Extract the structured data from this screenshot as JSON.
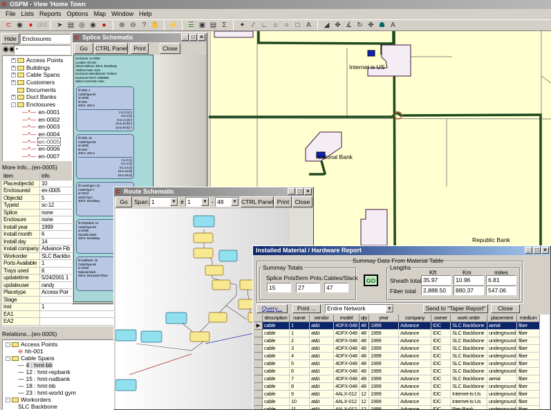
{
  "app": {
    "title": "OSPM - View 'Home Town"
  },
  "menu": [
    "File",
    "Lists",
    "Reports",
    "Options",
    "Map",
    "Window",
    "Help"
  ],
  "left": {
    "hide_label": "Hide",
    "layer_select": "Enclosures",
    "search_value": "*",
    "tree": [
      {
        "label": "Access Points",
        "level": 0,
        "exp": "+"
      },
      {
        "label": "Buildings",
        "level": 0,
        "exp": "+"
      },
      {
        "label": "Cable Spans",
        "level": 0,
        "exp": "+"
      },
      {
        "label": "Customers",
        "level": 0,
        "exp": "+"
      },
      {
        "label": "Documents",
        "level": 0,
        "exp": ""
      },
      {
        "label": "Duct Banks",
        "level": 0,
        "exp": "+"
      },
      {
        "label": "Enclosures",
        "level": 0,
        "exp": "-"
      },
      {
        "label": "en-0001",
        "level": 1
      },
      {
        "label": "en-0002",
        "level": 1
      },
      {
        "label": "en-0003",
        "level": 1
      },
      {
        "label": "en-0004",
        "level": 1
      },
      {
        "label": "en-0005",
        "level": 1,
        "selected": true
      },
      {
        "label": "en-0006",
        "level": 1
      },
      {
        "label": "en-0007",
        "level": 1
      }
    ],
    "more_info_title": "More Info...(en-0005)",
    "info_headers": [
      "item",
      "info"
    ],
    "info_rows": [
      [
        "Placeobjectid",
        "10"
      ],
      [
        "Enclosureid",
        "en-0005"
      ],
      [
        "Objectid",
        "5"
      ],
      [
        "Typeid",
        "sc-12"
      ],
      [
        "Splice",
        "none"
      ],
      [
        "Enclosure",
        "none"
      ],
      [
        "Install year",
        "1999"
      ],
      [
        "Install month",
        "6"
      ],
      [
        "Install day",
        "14"
      ],
      [
        "Install company",
        "Advance Fib"
      ],
      [
        "Workorder",
        "SLC Backbo"
      ],
      [
        "Ports Available",
        "1"
      ],
      [
        "Trays used",
        "6"
      ],
      [
        "updatetime",
        "5/24/2001 1"
      ],
      [
        "updateuser",
        "randy"
      ],
      [
        "Placetype",
        "Access Poir"
      ],
      [
        "Stage",
        ""
      ],
      [
        "inst",
        "1"
      ],
      [
        "EA1",
        ""
      ],
      [
        "EA2",
        ""
      ]
    ],
    "relations_title": "Relations...(en-0005)",
    "relations": [
      {
        "label": "Access Points",
        "level": 0,
        "kind": "folder"
      },
      {
        "label": "hh-001",
        "level": 1,
        "kind": "ap"
      },
      {
        "label": "Cable Spans",
        "level": 0,
        "kind": "folder"
      },
      {
        "label": "4 : hmt-bb",
        "level": 1,
        "kind": "span",
        "selected": true
      },
      {
        "label": "12 : hmt-repbank",
        "level": 1,
        "kind": "span"
      },
      {
        "label": "15 : hmt-natbank",
        "level": 1,
        "kind": "span"
      },
      {
        "label": "18 : hmt-bb",
        "level": 1,
        "kind": "span"
      },
      {
        "label": "23 : hmt-world gym",
        "level": 1,
        "kind": "span"
      },
      {
        "label": "Workorders",
        "level": 0,
        "kind": "folder"
      },
      {
        "label": "SLC Backbone",
        "level": 1,
        "kind": "wo"
      }
    ]
  },
  "splice": {
    "title": "Splice Schematic",
    "go": "Go",
    "ctrl": "CTRL Panel",
    "print": "Print",
    "close": "Close",
    "header": [
      "Enclosure: en-0005",
      "Location: hh-001",
      "Street Address: 300 E. Broadway",
      "Address Note: none",
      "Enclosure Manufacturer: Preform",
      "Enclosure Part #: 0000950",
      "Splice Comment: none"
    ],
    "cards": [
      {
        "lines": [
          "hh-hbb: 4",
          "CableType-60",
          "en-0005",
          "hh-002",
          "300 E. 200 S."
        ],
        "splices": [
          "1 to 2 (1)  1",
          "3 to 4 (2)",
          "5 to 14 (3)  3",
          "15 to 16 (5)  5",
          "16 to 40 (6)  7"
        ]
      },
      {
        "lines": [
          "hh-hbb: 18",
          "CableType-60",
          "en-0005",
          "hh-000",
          "400 E. 200 S."
        ],
        "splices": [
          "1 to 2 (1)",
          "3 to 4 (2)",
          "5 to 14 (3)",
          "15 to 16 (5)",
          "16 to 40 (6)"
        ]
      },
      {
        "lines": [
          "hh-world gym: 23",
          "CableType-7",
          "en-0013",
          "World Gym",
          "300 E. Broadway"
        ],
        "splices": []
      },
      {
        "lines": [
          "hh-Repbank: 12",
          "CableType-69",
          "en-0005",
          "Republic Bank",
          "250 E. Broadway"
        ],
        "splices": []
      },
      {
        "lines": [
          "hh-Natbank: 15",
          "CableType-69",
          "en-0003",
          "National Bank",
          "250 E. Brunswick Place"
        ],
        "splices": []
      }
    ]
  },
  "route": {
    "title": "Route Schematic",
    "go": "Go",
    "span_label": "Span:",
    "span_value": "1",
    "num_label": "#",
    "from_value": "1",
    "dash": "-",
    "to_value": "48",
    "ctrl": "CTRL Panel",
    "print": "Print",
    "close": "Close"
  },
  "map": {
    "labels": [
      "Internet is US",
      "National Bank",
      "Republic Bank"
    ]
  },
  "report": {
    "title": "Installed Material / Hardware Report",
    "group_title": "Summay Data From Material Table",
    "totals_title": "Summay Totals",
    "splice_label": "Splice Pnts.",
    "splice_value": "15",
    "term_label": "Term Pnts.",
    "term_value": "27",
    "cables_label": "Cables/Slack",
    "cables_value": "47",
    "go": "GO",
    "lengths_title": "Lengths",
    "cols": [
      "Kft",
      "Km",
      "miles"
    ],
    "sheath_label": "Sheath totals",
    "sheath": [
      "35.97",
      "10.96",
      "6.81"
    ],
    "fiber_label": "Fiber total",
    "fiber": [
      "2,888.50",
      "880.37",
      "547.06"
    ],
    "query": "Query...",
    "print": "Print ...",
    "scope": "Entire Network",
    "send": "Send to \"Taper Report\"",
    "close": "Close",
    "headers": [
      "description",
      "name",
      "vendor",
      "model",
      "qty",
      "year",
      "company",
      "owner",
      "work order",
      "placement",
      "medium"
    ],
    "rows": [
      [
        "cable",
        "1",
        "at&t",
        "4DFX-048",
        "48",
        "1999",
        "Advance",
        "IDC",
        "SLC Backbone",
        "aerial",
        "fiber"
      ],
      [
        "cable",
        "1",
        "at&t",
        "4DFX-048",
        "48",
        "1999",
        "Advance",
        "IDC",
        "SLC Backbone",
        "underground",
        "fiber"
      ],
      [
        "cable",
        "2",
        "at&t",
        "4DFX-048",
        "48",
        "1999",
        "Advance",
        "IDC",
        "SLC Backbone",
        "underground",
        "fiber"
      ],
      [
        "cable",
        "3",
        "at&t",
        "4DFX-048",
        "48",
        "1999",
        "Advance",
        "IDC",
        "SLC Backbone",
        "underground",
        "fiber"
      ],
      [
        "cable",
        "4",
        "at&t",
        "4DFX-048",
        "48",
        "1999",
        "Advance",
        "IDC",
        "SLC Backbone",
        "underground",
        "fiber"
      ],
      [
        "cable",
        "5",
        "at&t",
        "4DFX-048",
        "48",
        "1999",
        "Advance",
        "IDC",
        "SLC Backbone",
        "underground",
        "fiber"
      ],
      [
        "cable",
        "6",
        "at&t",
        "4DFX-048",
        "48",
        "1999",
        "Advance",
        "IDC",
        "SLC Backbone",
        "underground",
        "fiber"
      ],
      [
        "cable",
        "7",
        "at&t",
        "4DFX-048",
        "48",
        "1999",
        "Advance",
        "IDC",
        "SLC Backbone",
        "aerial",
        "fiber"
      ],
      [
        "cable",
        "8",
        "at&t",
        "4DFX-048",
        "48",
        "1999",
        "Advance",
        "IDC",
        "SLC Backbone",
        "underground",
        "fiber"
      ],
      [
        "cable",
        "9",
        "at&t",
        "4ALX-012",
        "12",
        "1999",
        "Advance",
        "IDC",
        "Internet-Is-Us",
        "underground",
        "fiber"
      ],
      [
        "cable",
        "10",
        "at&t",
        "4ALX-012",
        "12",
        "1999",
        "Advance",
        "IDC",
        "Internet-Is-Us",
        "underground",
        "fiber"
      ],
      [
        "cable",
        "11",
        "at&t",
        "4ALX-012",
        "12",
        "1999",
        "Advance",
        "IDC",
        "Rep Bank",
        "underground",
        "fiber"
      ]
    ]
  }
}
